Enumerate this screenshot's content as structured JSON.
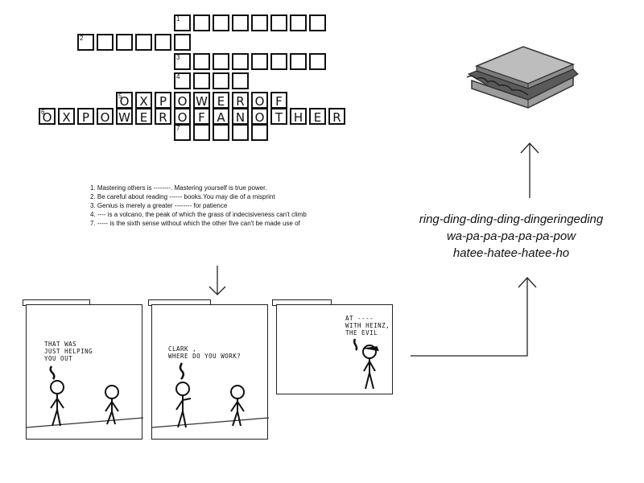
{
  "crossword": {
    "numbers": [
      "1",
      "2",
      "3",
      "4",
      "5",
      "6",
      "7"
    ],
    "row5_letters": [
      "O",
      "X",
      "P",
      "O",
      "W",
      "E",
      "R",
      "O",
      "F"
    ],
    "row6_letters": [
      "O",
      "X",
      "P",
      "O",
      "W",
      "E",
      "R",
      "O",
      "F",
      "A",
      "N",
      "O",
      "T",
      "H",
      "E",
      "R"
    ]
  },
  "clues": [
    "1.  Mastering others is --------. Mastering yourself is true power.",
    "2. Be careful about reading ------ books.You may die of a misprint",
    "3. Genius is merely a greater -------- for patience",
    "4. ---- is a volcano, the peak of which the grass of indecisiveness can't climb",
    "7. ----- is the sixth sense without which the other five can't be made use of"
  ],
  "onomatopoeia": [
    "ring-ding-ding-ding-dingeringeding",
    "wa-pa-pa-pa-pa-pa-pow",
    "hatee-hatee-hatee-ho"
  ],
  "comic": {
    "panel1_text": [
      "THAT WAS",
      "JUST HELPING",
      "YOU OUT"
    ],
    "panel2_text": [
      "CLARK ,",
      "WHERE DO YOU WORK?"
    ],
    "panel3_text": [
      "AT ----",
      "WITH HEINZ,",
      "THE EVIL"
    ]
  },
  "icons": {
    "sandwich": "sandwich-image",
    "arrows": [
      "arrow-down-icon",
      "arrow-up-icon",
      "arrow-up-icon"
    ]
  }
}
